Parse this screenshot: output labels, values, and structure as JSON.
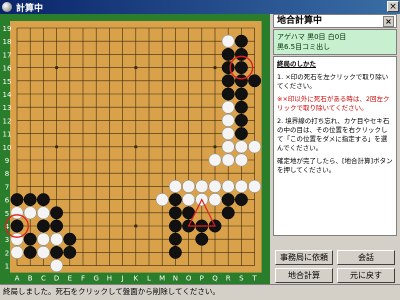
{
  "window": {
    "title": "計算中",
    "close_label": "×"
  },
  "board": {
    "size": 19,
    "col_labels": [
      "A",
      "B",
      "C",
      "D",
      "E",
      "F",
      "G",
      "H",
      "J",
      "K",
      "L",
      "M",
      "N",
      "O",
      "P",
      "Q",
      "R",
      "S",
      "T"
    ],
    "row_labels": [
      "19",
      "18",
      "17",
      "16",
      "15",
      "14",
      "13",
      "12",
      "11",
      "10",
      "9",
      "8",
      "7",
      "6",
      "5",
      "4",
      "3",
      "2",
      "1"
    ],
    "colors": {
      "board": "#d9a24a",
      "frame": "#2a7d2a",
      "line": "#3a2a10",
      "label": "#ffffff",
      "mark": "#e02020"
    },
    "black_stones": [
      [
        17,
        1
      ],
      [
        17,
        2
      ],
      [
        16,
        2
      ],
      [
        17,
        3
      ],
      [
        16,
        3
      ],
      [
        17,
        4
      ],
      [
        16,
        4
      ],
      [
        17,
        5
      ],
      [
        16,
        5
      ],
      [
        17,
        6
      ],
      [
        17,
        7
      ],
      [
        17,
        8
      ],
      [
        18,
        4
      ],
      [
        0,
        13
      ],
      [
        1,
        13
      ],
      [
        2,
        13
      ],
      [
        3,
        14
      ],
      [
        3,
        15
      ],
      [
        2,
        15
      ],
      [
        4,
        16
      ],
      [
        4,
        17
      ],
      [
        3,
        17
      ],
      [
        1,
        17
      ],
      [
        1,
        16
      ],
      [
        0,
        15
      ],
      [
        12,
        13
      ],
      [
        12,
        14
      ],
      [
        13,
        14
      ],
      [
        14,
        15
      ],
      [
        13,
        15
      ],
      [
        14,
        16
      ],
      [
        12,
        17
      ],
      [
        12,
        16
      ],
      [
        12,
        15
      ],
      [
        16,
        13
      ],
      [
        16,
        14
      ],
      [
        15,
        15
      ],
      [
        17,
        13
      ]
    ],
    "white_stones": [
      [
        16,
        1
      ],
      [
        16,
        6
      ],
      [
        16,
        7
      ],
      [
        16,
        8
      ],
      [
        16,
        9
      ],
      [
        16,
        10
      ],
      [
        15,
        10
      ],
      [
        17,
        10
      ],
      [
        17,
        9
      ],
      [
        18,
        9
      ],
      [
        14,
        12
      ],
      [
        15,
        12
      ],
      [
        16,
        12
      ],
      [
        13,
        12
      ],
      [
        17,
        12
      ],
      [
        18,
        12
      ],
      [
        12,
        12
      ],
      [
        11,
        13
      ],
      [
        13,
        13
      ],
      [
        14,
        13
      ],
      [
        15,
        13
      ],
      [
        0,
        14
      ],
      [
        1,
        14
      ],
      [
        2,
        14
      ],
      [
        0,
        16
      ],
      [
        2,
        16
      ],
      [
        3,
        16
      ],
      [
        2,
        17
      ],
      [
        3,
        18
      ],
      [
        0,
        17
      ]
    ],
    "dead_marks": [
      [
        17,
        3
      ],
      [
        0,
        15
      ]
    ],
    "triangle": [
      [
        14,
        13
      ],
      [
        13,
        15
      ],
      [
        15,
        15
      ]
    ]
  },
  "side": {
    "title": "地合計算中",
    "info_line1": "アゲハマ 黒0目 白0目",
    "info_line2": "黒6.5目コミ出し",
    "help_heading": "終局のしかた",
    "help_item1": "1. ×印の死石を左クリックで取り除いてください。",
    "help_note": "※×印以外に死石がある時は、2回左クリックで取り除いてください。",
    "help_item2": "2. 境界線の打ち忘れ、カケ目やセキ石の中の目は、その位置を右クリックして「この位置をダメに指定する」を選んでください。",
    "help_item3": "確定地が完了したら、[地合計算]ボタンを押してください。"
  },
  "buttons": {
    "office_request": "事務局に依頼",
    "chat": "会話",
    "calculate": "地合計算",
    "undo": "元に戻す"
  },
  "status": {
    "text": "終局しました。死石をクリックして盤面から削除してください。"
  }
}
